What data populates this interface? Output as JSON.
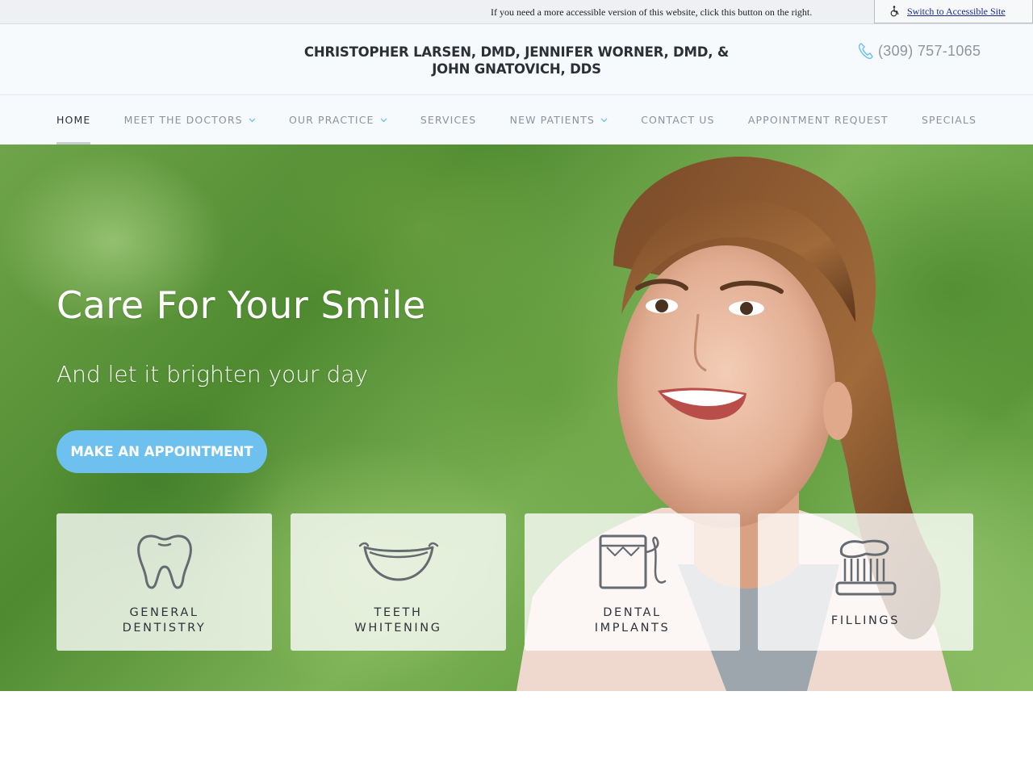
{
  "accessibility": {
    "message": "If you need a more accessible version of this website, click this button on the right.",
    "button_label": "Switch to Accessible Site",
    "icon": "wheelchair-icon"
  },
  "header": {
    "practice_line1": "CHRISTOPHER LARSEN, DMD, JENNIFER WORNER, DMD, &",
    "practice_line2": "JOHN GNATOVICH, DDS",
    "phone": "(309) 757-1065",
    "phone_icon": "phone-icon"
  },
  "nav": {
    "items": [
      {
        "label": "HOME",
        "active": true,
        "dropdown": false
      },
      {
        "label": "MEET THE DOCTORS",
        "active": false,
        "dropdown": true
      },
      {
        "label": "OUR PRACTICE",
        "active": false,
        "dropdown": true
      },
      {
        "label": "SERVICES",
        "active": false,
        "dropdown": false
      },
      {
        "label": "NEW PATIENTS",
        "active": false,
        "dropdown": true
      },
      {
        "label": "CONTACT US",
        "active": false,
        "dropdown": false
      },
      {
        "label": "APPOINTMENT REQUEST",
        "active": false,
        "dropdown": false
      },
      {
        "label": "SPECIALS",
        "active": false,
        "dropdown": false
      }
    ]
  },
  "hero": {
    "title": "Care For Your Smile",
    "subtitle": "And let it brighten your day",
    "cta_label": "MAKE AN APPOINTMENT",
    "cards": [
      {
        "label": "GENERAL\nDENTISTRY",
        "icon": "tooth-icon"
      },
      {
        "label": "TEETH\nWHITENING",
        "icon": "smile-icon"
      },
      {
        "label": "DENTAL\nIMPLANTS",
        "icon": "floss-icon"
      },
      {
        "label": "FILLINGS",
        "icon": "toothbrush-icon"
      }
    ]
  },
  "colors": {
    "accent": "#6ec1ef",
    "nav_text": "#8a929c",
    "nav_active": "#2b2f36",
    "chevron": "#6ec1ef"
  }
}
